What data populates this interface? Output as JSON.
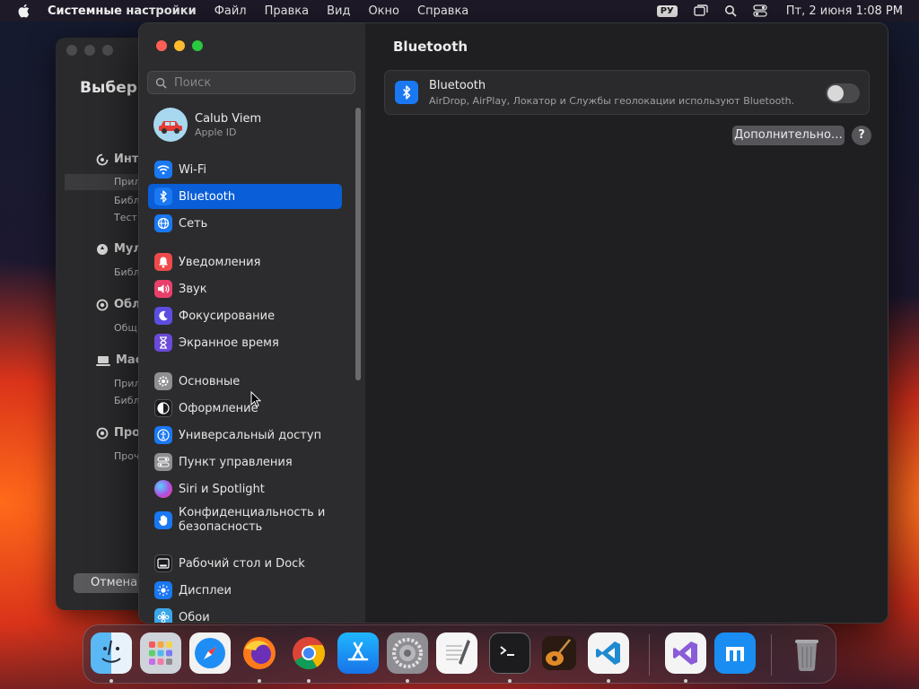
{
  "menubar": {
    "app_name": "Системные настройки",
    "items": [
      "Файл",
      "Правка",
      "Вид",
      "Окно",
      "Справка"
    ],
    "input_language": "РУ",
    "clock": "Пт, 2 июня  1:08 PM"
  },
  "back_window": {
    "title": "Выбери",
    "groups": [
      {
        "label": "Инт",
        "subs": [
          "Прил",
          "Библ",
          "Тест"
        ]
      },
      {
        "label": "Мул",
        "subs": [
          "Библ"
        ]
      },
      {
        "label": "Обл",
        "subs": [
          "Общ"
        ]
      },
      {
        "label": "Мас",
        "subs": [
          "Прил",
          "Библ"
        ]
      },
      {
        "label": "Про",
        "subs": [
          "Проч"
        ]
      }
    ],
    "cancel_label": "Отмена"
  },
  "sidebar": {
    "search_placeholder": "Поиск",
    "account": {
      "name": "Calub Viem",
      "subtitle": "Apple ID"
    },
    "items": [
      {
        "label": "Wi-Fi",
        "icon": "wifi-icon",
        "color": "#1a78f2"
      },
      {
        "label": "Bluetooth",
        "icon": "bluetooth-icon",
        "color": "#1a78f2"
      },
      {
        "label": "Сеть",
        "icon": "globe-icon",
        "color": "#1a78f2"
      },
      {
        "label": "Уведомления",
        "icon": "bell-icon",
        "color": "#ee4a4a"
      },
      {
        "label": "Звук",
        "icon": "speaker-icon",
        "color": "#e8406a"
      },
      {
        "label": "Фокусирование",
        "icon": "moon-icon",
        "color": "#5c4ee0"
      },
      {
        "label": "Экранное время",
        "icon": "hourglass-icon",
        "color": "#6a4ad8"
      },
      {
        "label": "Основные",
        "icon": "gear-icon",
        "color": "#8e8e93"
      },
      {
        "label": "Оформление",
        "icon": "appearance-icon",
        "color": "#1c1c1e"
      },
      {
        "label": "Универсальный доступ",
        "icon": "accessibility-icon",
        "color": "#1a78f2"
      },
      {
        "label": "Пункт управления",
        "icon": "control-center-icon",
        "color": "#8e8e93"
      },
      {
        "label": "Siri и Spotlight",
        "icon": "siri-icon",
        "color": "#b04fe0"
      },
      {
        "label": "Конфиденциальность и безопасность",
        "icon": "hand-icon",
        "color": "#1a78f2"
      },
      {
        "label": "Рабочий стол и Dock",
        "icon": "dock-icon",
        "color": "#1c1c1e"
      },
      {
        "label": "Дисплеи",
        "icon": "sun-icon",
        "color": "#1a78f2"
      },
      {
        "label": "Обои",
        "icon": "wallpaper-icon",
        "color": "#3aa7e8"
      }
    ]
  },
  "content": {
    "title": "Bluetooth",
    "card_title": "Bluetooth",
    "card_desc": "AirDrop, AirPlay, Локатор и Службы геолокации используют Bluetooth.",
    "toggle_on": false,
    "advanced_label": "Дополнительно…",
    "help_label": "?"
  },
  "dock": {
    "apps": [
      "Finder",
      "Launchpad",
      "Safari",
      "Firefox",
      "Chrome",
      "App Store",
      "System Settings",
      "TextEdit",
      "Terminal",
      "GarageBand",
      "Visual Studio Code",
      "Visual Studio",
      "Maxthon",
      "Trash"
    ]
  }
}
